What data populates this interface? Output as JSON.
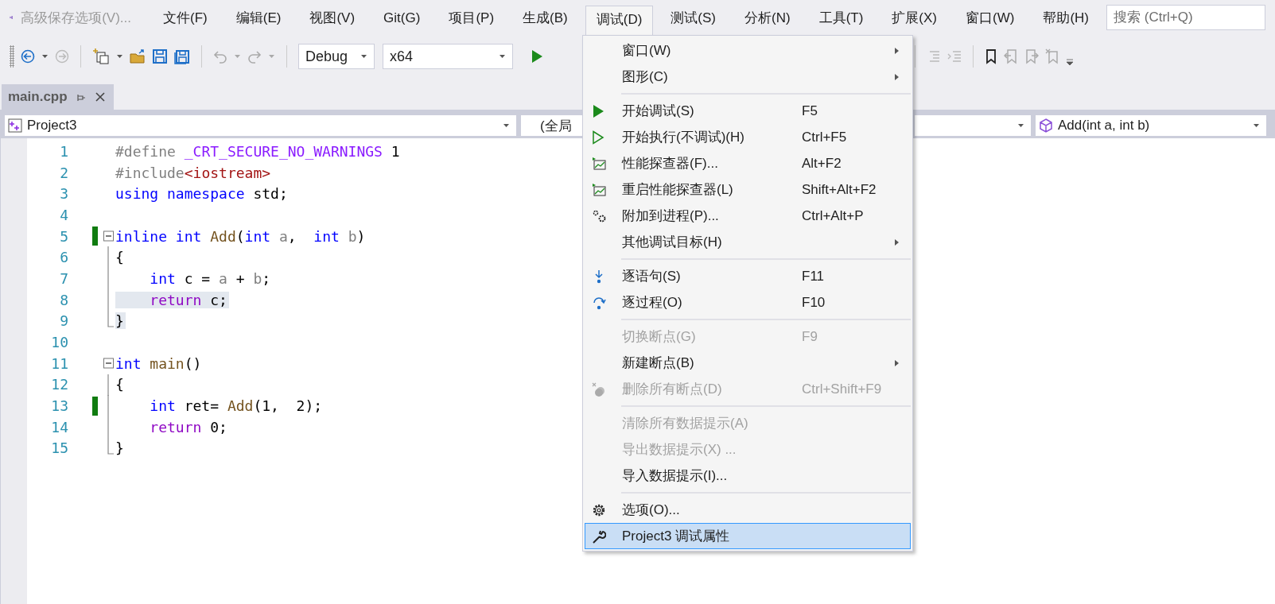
{
  "title_bar": {
    "title": "高级保存选项(V)...",
    "search": {
      "placeholder": "搜索 (Ctrl+Q)"
    }
  },
  "menubar": {
    "items": [
      {
        "label": "文件(F)",
        "selected": false
      },
      {
        "label": "编辑(E)",
        "selected": false
      },
      {
        "label": "视图(V)",
        "selected": false
      },
      {
        "label": "Git(G)",
        "selected": false
      },
      {
        "label": "项目(P)",
        "selected": false
      },
      {
        "label": "生成(B)",
        "selected": false
      },
      {
        "label": "调试(D)",
        "selected": true
      },
      {
        "label": "测试(S)",
        "selected": false
      },
      {
        "label": "分析(N)",
        "selected": false
      },
      {
        "label": "工具(T)",
        "selected": false
      },
      {
        "label": "扩展(X)",
        "selected": false
      },
      {
        "label": "窗口(W)",
        "selected": false
      },
      {
        "label": "帮助(H)",
        "selected": false
      }
    ]
  },
  "toolbar": {
    "configuration": "Debug",
    "platform": "x64"
  },
  "tabs": [
    {
      "label": "main.cpp",
      "selected": true
    }
  ],
  "navbar": {
    "project": "Project3",
    "scope": "(全局",
    "member": "Add(int a, int b)"
  },
  "editor": {
    "lines": [
      {
        "number": "1",
        "changed": false,
        "highlighted": false,
        "tokens": [
          {
            "kind": "preproc",
            "text": "#define "
          },
          {
            "kind": "macro",
            "text": "_CRT_SECURE_NO_WARNINGS"
          },
          {
            "kind": "plain",
            "text": " 1"
          }
        ]
      },
      {
        "number": "2",
        "changed": false,
        "highlighted": false,
        "tokens": [
          {
            "kind": "preproc",
            "text": "#include"
          },
          {
            "kind": "include",
            "text": "<iostream>"
          }
        ]
      },
      {
        "number": "3",
        "changed": false,
        "highlighted": false,
        "tokens": [
          {
            "kind": "keyword",
            "text": "using namespace"
          },
          {
            "kind": "plain",
            "text": " std;"
          }
        ]
      },
      {
        "number": "4",
        "changed": false,
        "highlighted": false
      },
      {
        "number": "5",
        "changed": true,
        "highlighted": false,
        "expanded": true,
        "tokens": [
          {
            "kind": "keyword",
            "text": "inline int "
          },
          {
            "kind": "func",
            "text": "Add"
          },
          {
            "kind": "plain",
            "text": "("
          },
          {
            "kind": "keyword",
            "text": "int "
          },
          {
            "kind": "param",
            "text": "a"
          },
          {
            "kind": "plain",
            "text": ",  "
          },
          {
            "kind": "keyword",
            "text": "int "
          },
          {
            "kind": "param",
            "text": "b"
          },
          {
            "kind": "plain",
            "text": ")"
          }
        ],
        "children": [
          {
            "number": "6",
            "changed": false,
            "highlighted": false,
            "tokens": [
              {
                "kind": "plain",
                "text": "{"
              }
            ]
          },
          {
            "number": "7",
            "changed": false,
            "highlighted": false,
            "tokens": [
              {
                "kind": "keyword",
                "text": "    int"
              },
              {
                "kind": "plain",
                "text": " c = "
              },
              {
                "kind": "param",
                "text": "a"
              },
              {
                "kind": "plain",
                "text": " + "
              },
              {
                "kind": "param",
                "text": "b"
              },
              {
                "kind": "plain",
                "text": ";"
              }
            ]
          },
          {
            "number": "8",
            "changed": false,
            "highlighted": true,
            "tokens": [
              {
                "kind": "control",
                "text": "    return"
              },
              {
                "kind": "plain",
                "text": " c;"
              }
            ]
          },
          {
            "number": "9",
            "changed": false,
            "highlighted": true,
            "tokens": [
              {
                "kind": "plain",
                "text": "}"
              }
            ]
          }
        ]
      },
      {
        "number": "10",
        "changed": false,
        "highlighted": false
      },
      {
        "number": "11",
        "changed": false,
        "highlighted": false,
        "expanded": true,
        "tokens": [
          {
            "kind": "keyword",
            "text": "int "
          },
          {
            "kind": "func",
            "text": "main"
          },
          {
            "kind": "plain",
            "text": "()"
          }
        ],
        "children": [
          {
            "number": "12",
            "changed": false,
            "highlighted": false,
            "tokens": [
              {
                "kind": "plain",
                "text": "{"
              }
            ]
          },
          {
            "number": "13",
            "changed": true,
            "highlighted": false,
            "tokens": [
              {
                "kind": "keyword",
                "text": "    int"
              },
              {
                "kind": "plain",
                "text": " ret= "
              },
              {
                "kind": "func",
                "text": "Add"
              },
              {
                "kind": "plain",
                "text": "(1,  2);"
              }
            ]
          },
          {
            "number": "14",
            "changed": false,
            "highlighted": false,
            "tokens": [
              {
                "kind": "control",
                "text": "    return"
              },
              {
                "kind": "plain",
                "text": " 0;"
              }
            ]
          },
          {
            "number": "15",
            "changed": false,
            "highlighted": false,
            "tokens": [
              {
                "kind": "plain",
                "text": "}"
              }
            ]
          }
        ]
      }
    ]
  },
  "debug_menu": {
    "groups": [
      [
        {
          "label": "窗口(W)",
          "submenu": true,
          "disabled": false,
          "selected": false
        },
        {
          "label": "图形(C)",
          "submenu": true,
          "disabled": false,
          "selected": false
        }
      ],
      [
        {
          "label": "开始调试(S)",
          "shortcut": "F5",
          "submenu": false,
          "disabled": false,
          "selected": false
        },
        {
          "label": "开始执行(不调试)(H)",
          "shortcut": "Ctrl+F5",
          "submenu": false,
          "disabled": false,
          "selected": false
        },
        {
          "label": "性能探查器(F)...",
          "shortcut": "Alt+F2",
          "submenu": false,
          "disabled": false,
          "selected": false
        },
        {
          "label": "重启性能探查器(L)",
          "shortcut": "Shift+Alt+F2",
          "submenu": false,
          "disabled": false,
          "selected": false
        },
        {
          "label": "附加到进程(P)...",
          "shortcut": "Ctrl+Alt+P",
          "submenu": false,
          "disabled": false,
          "selected": false
        },
        {
          "label": "其他调试目标(H)",
          "submenu": true,
          "disabled": false,
          "selected": false
        }
      ],
      [
        {
          "label": "逐语句(S)",
          "shortcut": "F11",
          "submenu": false,
          "disabled": false,
          "selected": false
        },
        {
          "label": "逐过程(O)",
          "shortcut": "F10",
          "submenu": false,
          "disabled": false,
          "selected": false
        }
      ],
      [
        {
          "label": "切换断点(G)",
          "shortcut": "F9",
          "submenu": false,
          "disabled": true,
          "selected": false
        },
        {
          "label": "新建断点(B)",
          "submenu": true,
          "disabled": false,
          "selected": false
        },
        {
          "label": "删除所有断点(D)",
          "shortcut": "Ctrl+Shift+F9",
          "submenu": false,
          "disabled": true,
          "selected": false
        }
      ],
      [
        {
          "label": "清除所有数据提示(A)",
          "submenu": false,
          "disabled": true,
          "selected": false
        },
        {
          "label": "导出数据提示(X) ...",
          "submenu": false,
          "disabled": true,
          "selected": false
        },
        {
          "label": "导入数据提示(I)...",
          "submenu": false,
          "disabled": false,
          "selected": false
        }
      ],
      [
        {
          "label": "选项(O)...",
          "submenu": false,
          "disabled": false,
          "selected": false
        },
        {
          "label": "Project3 调试属性",
          "submenu": false,
          "disabled": false,
          "selected": true
        }
      ]
    ]
  }
}
